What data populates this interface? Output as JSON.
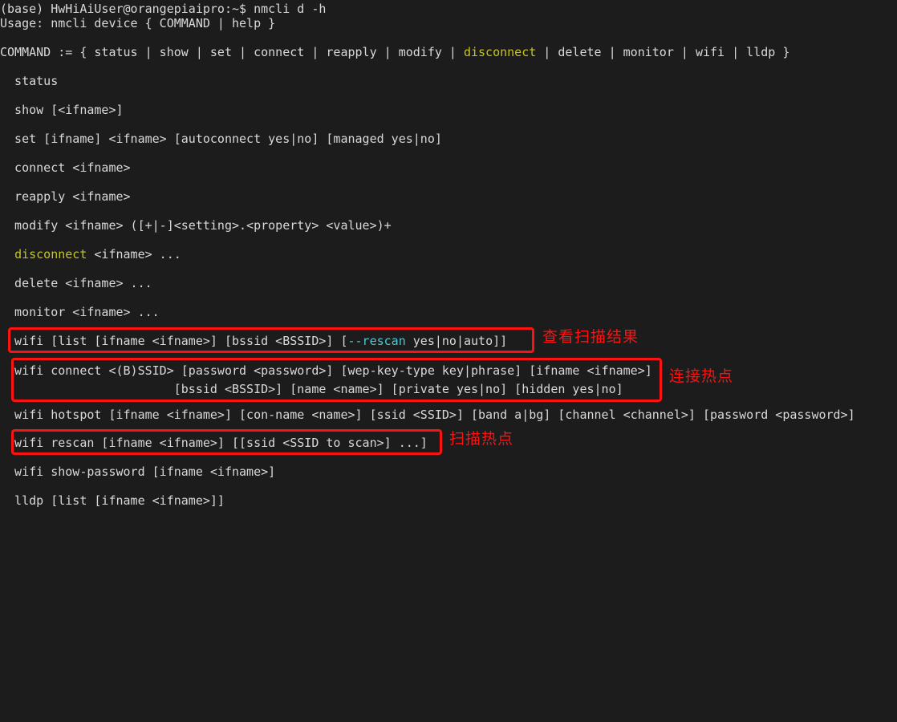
{
  "terminal": {
    "background": "#1c1c1c",
    "foreground": "#d9d9d9",
    "accent_yellow": "#c5c521",
    "accent_cyan": "#4ec9d4",
    "annotation_red": "#fb1212",
    "prompt_line": "(base) HwHiAiUser@orangepiaipro:~$ nmcli d -h",
    "usage_line": "Usage: nmcli device { COMMAND | help }",
    "command_header": {
      "prefix": "COMMAND := { status | show | set | connect | reapply | modify | ",
      "highlight": "disconnect",
      "suffix": " | delete | monitor | wifi | lldp }"
    },
    "commands": [
      {
        "text": "  status"
      },
      {
        "text": "  show [<ifname>]"
      },
      {
        "text": "  set [ifname] <ifname> [autoconnect yes|no] [managed yes|no]"
      },
      {
        "text": "  connect <ifname>"
      },
      {
        "text": "  reapply <ifname>"
      },
      {
        "text": "  modify <ifname> ([+|-]<setting>.<property> <value>)+"
      },
      {
        "prefix": "  ",
        "highlight": "disconnect",
        "suffix": " <ifname> ..."
      },
      {
        "text": "  delete <ifname> ..."
      },
      {
        "text": "  monitor <ifname> ..."
      }
    ],
    "wifi_list": {
      "prefix": "  wifi [list [ifname <ifname>] [bssid <BSSID>] [",
      "cyan": "--rescan",
      "suffix": " yes|no|auto]]"
    },
    "wifi_connect_line1": "  wifi connect <(B)SSID> [password <password>] [wep-key-type key|phrase] [ifname <ifname>]",
    "wifi_connect_line2": "                        [bssid <BSSID>] [name <name>] [private yes|no] [hidden yes|no]",
    "wifi_hotspot": "  wifi hotspot [ifname <ifname>] [con-name <name>] [ssid <SSID>] [band a|bg] [channel <channel>] [password <password>]",
    "wifi_rescan": "  wifi rescan [ifname <ifname>] [[ssid <SSID to scan>] ...]",
    "wifi_show_password": "  wifi show-password [ifname <ifname>]",
    "lldp": "  lldp [list [ifname <ifname>]]"
  },
  "annotations": [
    {
      "label": "查看扫描结果",
      "meaning": "view-scan-results"
    },
    {
      "label": "连接热点",
      "meaning": "connect-hotspot"
    },
    {
      "label": "扫描热点",
      "meaning": "scan-hotspot"
    }
  ]
}
